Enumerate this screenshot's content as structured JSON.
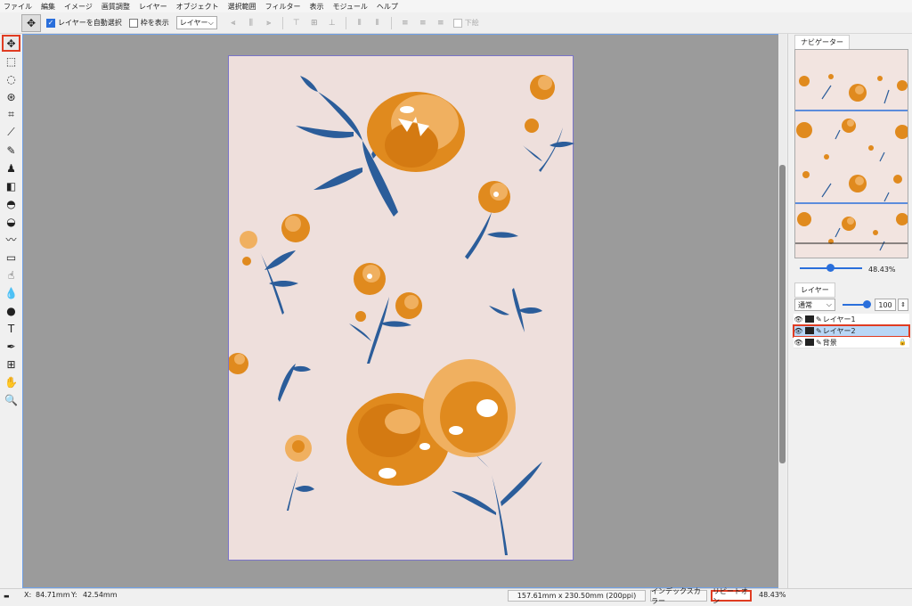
{
  "menu": [
    "ファイル",
    "編集",
    "イメージ",
    "画質調整",
    "レイヤー",
    "オブジェクト",
    "選択範囲",
    "フィルター",
    "表示",
    "モジュール",
    "ヘルプ"
  ],
  "options": {
    "auto_select_label": "レイヤーを自動選択",
    "show_bounds_label": "枠を表示",
    "target_select_value": "レイヤー",
    "bottom_label": "下絵"
  },
  "navigator": {
    "tab_label": "ナビゲーター",
    "zoom_value": "48.43%"
  },
  "layers_panel": {
    "tab_label": "レイヤー",
    "blend_mode": "通常",
    "opacity_value": "100",
    "layers": [
      {
        "name": "レイヤー1",
        "active": false,
        "locked": false
      },
      {
        "name": "レイヤー2",
        "active": true,
        "locked": false
      },
      {
        "name": "背景",
        "active": false,
        "locked": true
      }
    ]
  },
  "status": {
    "x_label": "X:",
    "x_value": "84.71mm",
    "y_label": "Y:",
    "y_value": "42.54mm",
    "doc_size": "157.61mm x 230.50mm (200ppi)",
    "index_color_button": "インデックスカラー",
    "repeat_button": "リピートオン",
    "zoom": "48.43%"
  },
  "colors": {
    "canvas_bg": "#eedfdc",
    "workspace_bg": "#9b9b9b",
    "flower_orange": "#e08a1e",
    "flower_light": "#f0b060",
    "leaf_blue": "#2b5d9a",
    "highlight_red": "#e03c22",
    "accent_blue": "#2a6fdb"
  }
}
